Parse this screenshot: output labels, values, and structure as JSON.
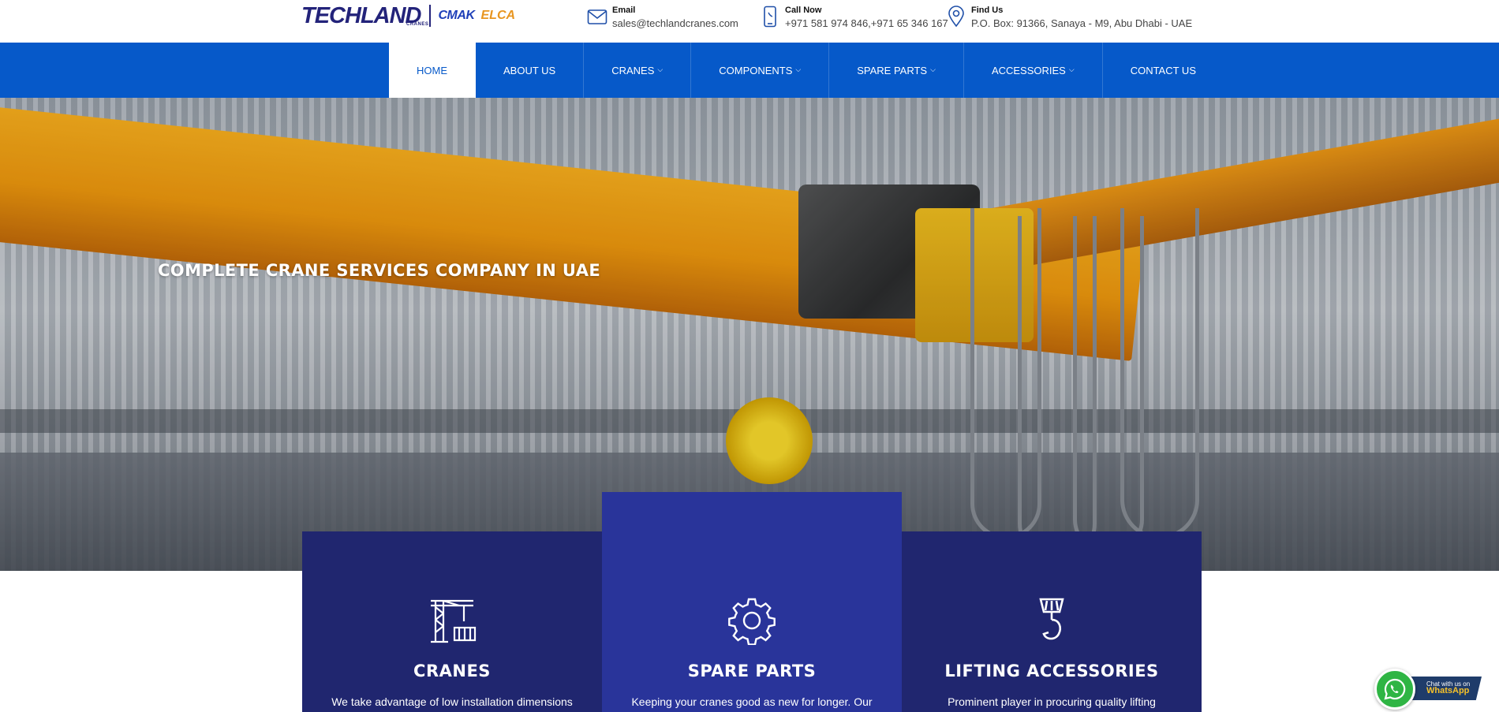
{
  "logo": {
    "brand": "TECHLAND",
    "brand_sub": "CRANES",
    "partner_1": "CMAK",
    "partner_2": "ELCA"
  },
  "contacts": {
    "email": {
      "label": "Email",
      "value": "sales@techlandcranes.com",
      "icon": "mail-icon"
    },
    "call": {
      "label": "Call Now",
      "value": "+971 581 974 846,+971 65 346 167",
      "icon": "phone-icon"
    },
    "find": {
      "label": "Find Us",
      "value": "P.O. Box: 91366, Sanaya - M9, Abu Dhabi - UAE",
      "icon": "location-pin-icon"
    }
  },
  "nav": {
    "items": [
      {
        "label": "HOME",
        "active": true,
        "dropdown": false
      },
      {
        "label": "ABOUT US",
        "active": false,
        "dropdown": false
      },
      {
        "label": "CRANES",
        "active": false,
        "dropdown": true
      },
      {
        "label": "COMPONENTS",
        "active": false,
        "dropdown": true
      },
      {
        "label": "SPARE PARTS",
        "active": false,
        "dropdown": true
      },
      {
        "label": "ACCESSORIES",
        "active": false,
        "dropdown": true
      },
      {
        "label": "CONTACT US",
        "active": false,
        "dropdown": false
      }
    ],
    "chevron": "⌵"
  },
  "hero": {
    "title": "COMPLETE CRANE SERVICES COMPANY IN UAE"
  },
  "services": [
    {
      "title": "CRANES",
      "desc": "We take advantage of low installation dimensions",
      "icon": "tower-crane-icon"
    },
    {
      "title": "SPARE PARTS",
      "desc": "Keeping your cranes good as new for longer. Our",
      "icon": "gear-icon"
    },
    {
      "title": "LIFTING ACCESSORIES",
      "desc": "Prominent player in procuring quality lifting",
      "icon": "crane-hook-icon"
    }
  ],
  "whatsapp": {
    "line1": "Chat with us on",
    "line2": "WhatsApp",
    "icon": "whatsapp-icon"
  },
  "colors": {
    "nav_bg": "#0659c9",
    "card_dark": "#20266f",
    "card_mid": "#29349a",
    "brand_navy": "#23237a",
    "elca_orange": "#e8951f"
  }
}
